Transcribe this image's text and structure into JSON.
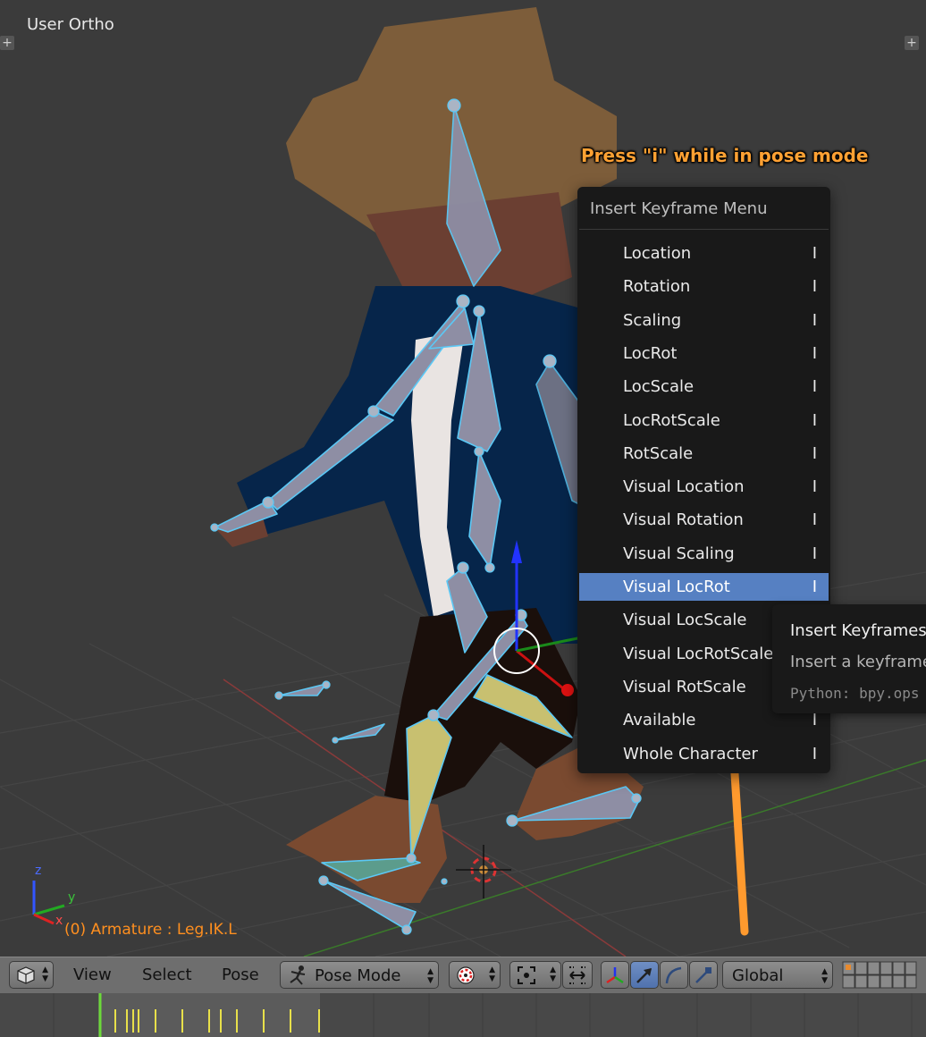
{
  "viewport": {
    "title": "User Ortho",
    "object_info": "(0) Armature : Leg.IK.L",
    "annotation": "Press \"i\" while in pose mode",
    "axis_labels": {
      "x": "x",
      "y": "y",
      "z": "z"
    }
  },
  "menu": {
    "title": "Insert Keyframe Menu",
    "shortcut": "I",
    "active_index": 9,
    "items": [
      {
        "label": "Location"
      },
      {
        "label": "Rotation"
      },
      {
        "label": "Scaling"
      },
      {
        "label": "LocRot"
      },
      {
        "label": "LocScale"
      },
      {
        "label": "LocRotScale"
      },
      {
        "label": "RotScale"
      },
      {
        "label": "Visual Location"
      },
      {
        "label": "Visual Rotation"
      },
      {
        "label": "Visual Scaling"
      },
      {
        "label": "Visual LocRot"
      },
      {
        "label": "Visual LocScale"
      },
      {
        "label": "Visual LocRotScale"
      },
      {
        "label": "Visual RotScale"
      },
      {
        "label": "Available"
      },
      {
        "label": "Whole Character"
      }
    ]
  },
  "tooltip": {
    "title": "Insert Keyframes",
    "description": "Insert a keyframe",
    "python": "Python: bpy.ops"
  },
  "header": {
    "menus": {
      "view": "View",
      "select": "Select",
      "pose": "Pose"
    },
    "mode": "Pose Mode",
    "orientation": "Global"
  },
  "colors": {
    "menu_bg": "#191919",
    "menu_highlight": "#5680c2",
    "annotation": "#ffa133",
    "object_info": "#ff8f1f",
    "bone_outline": "#5bc8f5",
    "arrow": "#ff9a2e"
  }
}
